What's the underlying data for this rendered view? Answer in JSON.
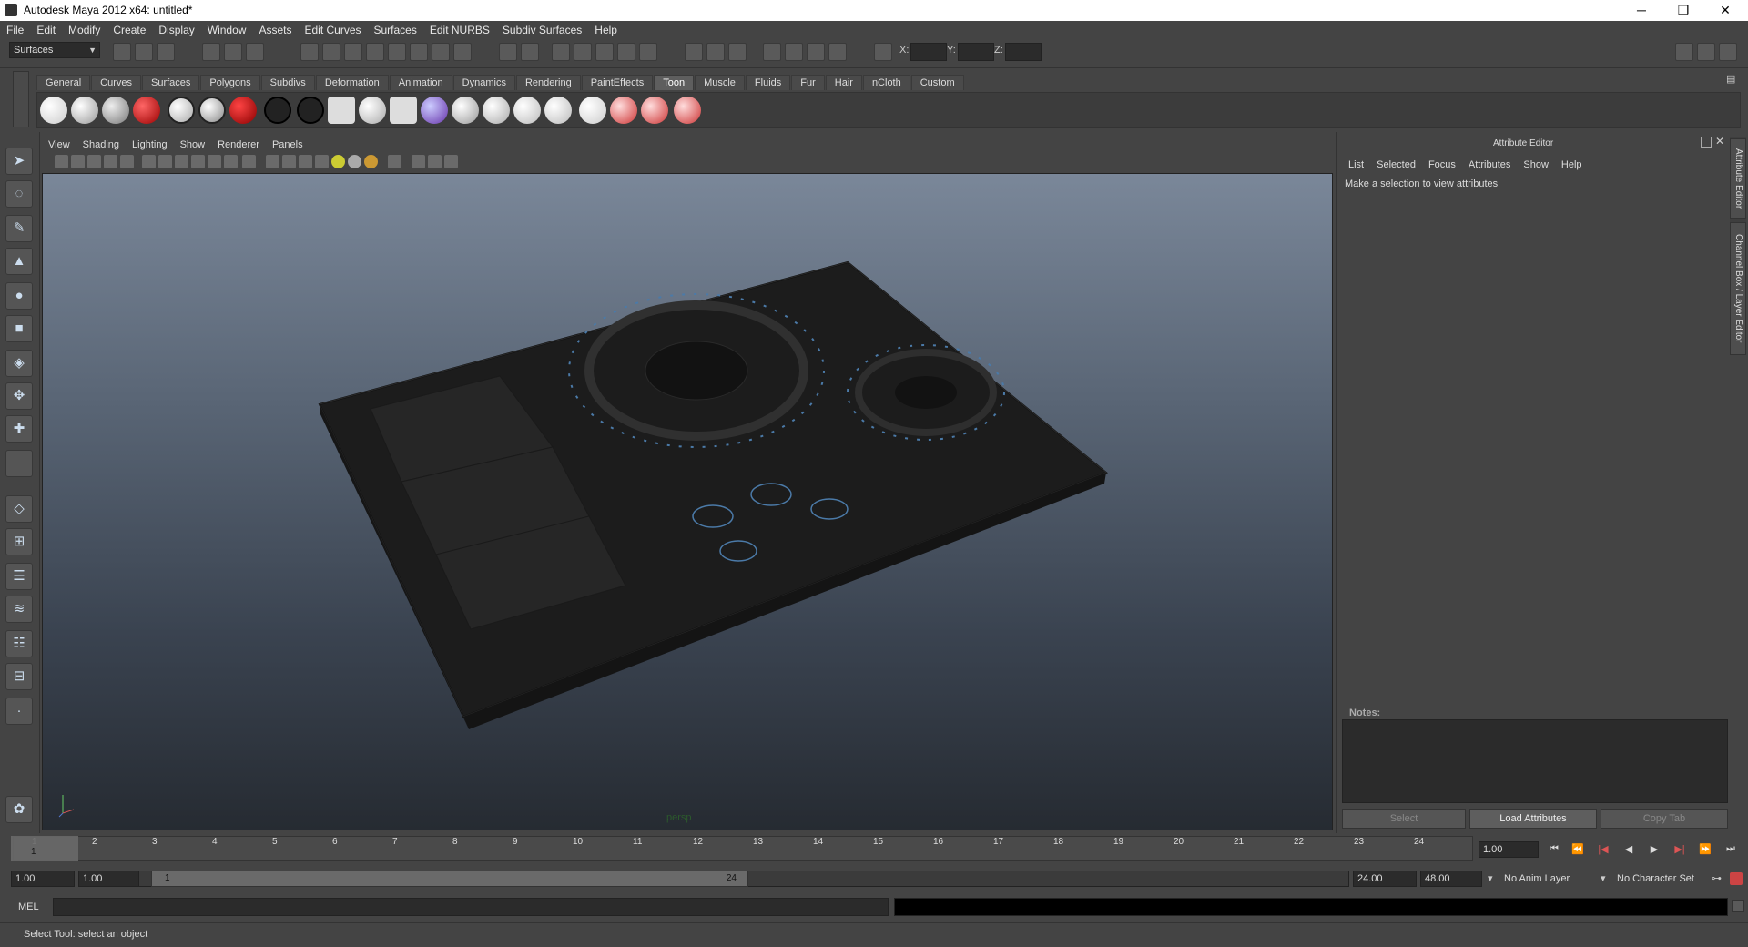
{
  "window": {
    "title": "Autodesk Maya 2012 x64: untitled*",
    "minimize": "─",
    "restore": "❐",
    "close": "✕"
  },
  "menubar": [
    "File",
    "Edit",
    "Modify",
    "Create",
    "Display",
    "Window",
    "Assets",
    "Edit Curves",
    "Surfaces",
    "Edit NURBS",
    "Subdiv Surfaces",
    "Help"
  ],
  "statusline": {
    "menuset": "Surfaces",
    "x_label": "X:",
    "y_label": "Y:",
    "z_label": "Z:"
  },
  "shelf": {
    "tabs": [
      "General",
      "Curves",
      "Surfaces",
      "Polygons",
      "Subdivs",
      "Deformation",
      "Animation",
      "Dynamics",
      "Rendering",
      "PaintEffects",
      "Toon",
      "Muscle",
      "Fluids",
      "Fur",
      "Hair",
      "nCloth",
      "Custom"
    ],
    "active": "Toon"
  },
  "panel": {
    "menus": [
      "View",
      "Shading",
      "Lighting",
      "Show",
      "Renderer",
      "Panels"
    ],
    "camera": "persp"
  },
  "attribute_editor": {
    "title": "Attribute Editor",
    "menus": [
      "List",
      "Selected",
      "Focus",
      "Attributes",
      "Show",
      "Help"
    ],
    "message": "Make a selection to view attributes",
    "notes_label": "Notes:",
    "buttons": [
      "Select",
      "Load Attributes",
      "Copy Tab"
    ]
  },
  "side_tabs": [
    "Attribute Editor",
    "Channel Box / Layer Editor"
  ],
  "timeline": {
    "ticks": [
      "1",
      "2",
      "3",
      "4",
      "5",
      "6",
      "7",
      "8",
      "9",
      "10",
      "11",
      "12",
      "13",
      "14",
      "15",
      "16",
      "17",
      "18",
      "19",
      "20",
      "21",
      "22",
      "23",
      "24"
    ],
    "current_frame_marker": "1",
    "current_time": "1.00"
  },
  "range": {
    "start": "1.00",
    "playback_start": "1.00",
    "slider_start": "1",
    "slider_end": "24",
    "playback_end": "24.00",
    "end": "48.00",
    "anim_layer": "No Anim Layer",
    "character_set": "No Character Set"
  },
  "playback": [
    "⏮",
    "⏪",
    "|◀",
    "◀",
    "▶",
    "▶|",
    "⏩",
    "⏭"
  ],
  "command_line": {
    "label": "MEL"
  },
  "help_line": "Select Tool: select an object"
}
